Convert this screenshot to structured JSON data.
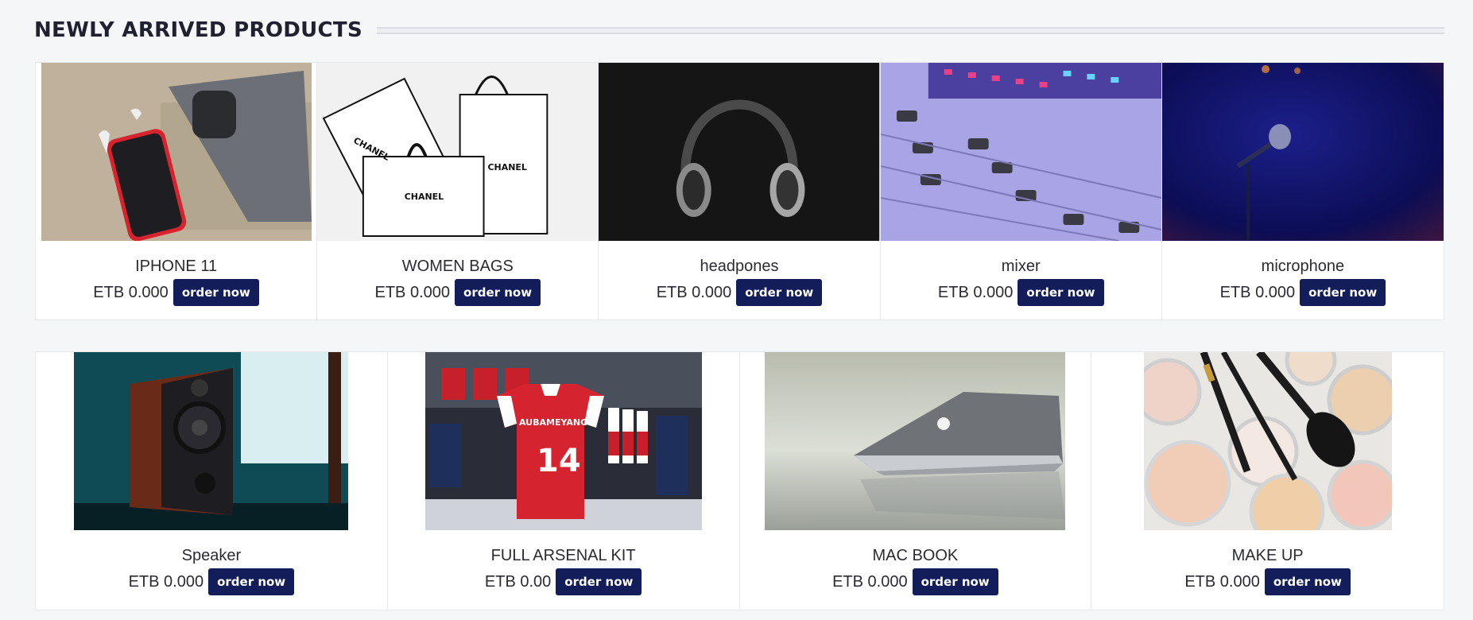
{
  "section": {
    "title": "NEWLY ARRIVED PRODUCTS"
  },
  "order_label": "order now",
  "products": [
    {
      "name": "IPHONE 11",
      "price": "ETB 0.000"
    },
    {
      "name": "WOMEN BAGS",
      "price": "ETB 0.000"
    },
    {
      "name": "headpones",
      "price": "ETB 0.000"
    },
    {
      "name": "mixer",
      "price": "ETB 0.000"
    },
    {
      "name": "microphone",
      "price": "ETB 0.000"
    },
    {
      "name": "Speaker",
      "price": "ETB 0.000"
    },
    {
      "name": "FULL ARSENAL KIT",
      "price": "ETB 0.00"
    },
    {
      "name": "MAC BOOK",
      "price": "ETB 0.000"
    },
    {
      "name": "MAKE UP",
      "price": "ETB 0.000"
    }
  ],
  "photo_marks": {
    "bags_brand": "CHANEL",
    "jersey_name": "AUBAMEYANG",
    "jersey_number": "14"
  },
  "colors": {
    "button_bg": "#121d5a",
    "button_text": "#ffffff",
    "page_bg": "#f5f6f8"
  }
}
